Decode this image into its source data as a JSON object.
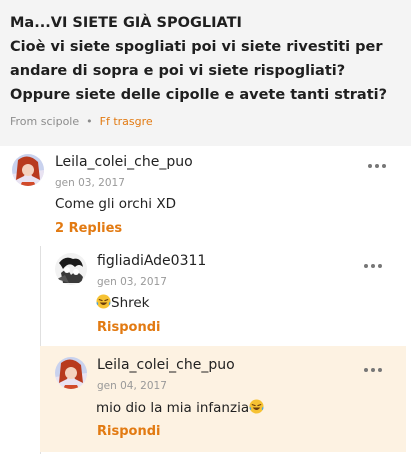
{
  "post": {
    "title": "Ma...VI SIETE GIÀ SPOGLIATI",
    "body": "Cioè vi siete spogliati poi vi siete rivestiti per andare di sopra e poi vi siete rispogliati? Oppure siete delle cipolle e avete tanti strati?",
    "source": "From scipole",
    "tag": "Ff trasgre"
  },
  "comments": [
    {
      "user": "Leila_colei_che_puo",
      "date": "gen 03, 2017",
      "text": "Come gli orchi XD",
      "replies_link": "2 Replies",
      "replies": [
        {
          "user": "figliadiAde0311",
          "date": "gen 03, 2017",
          "text": "Shrek",
          "emoji": "laughing-tears-emoji",
          "action": "Rispondi"
        },
        {
          "user": "Leila_colei_che_puo",
          "date": "gen 04, 2017",
          "text": "mio dio la mia infanzia",
          "emoji": "laughing-tears-emoji",
          "action": "Rispondi"
        }
      ]
    }
  ],
  "colors": {
    "accent": "#e27a12",
    "header_bg": "#f4f4f4",
    "highlight_bg": "#fdf2e2"
  }
}
